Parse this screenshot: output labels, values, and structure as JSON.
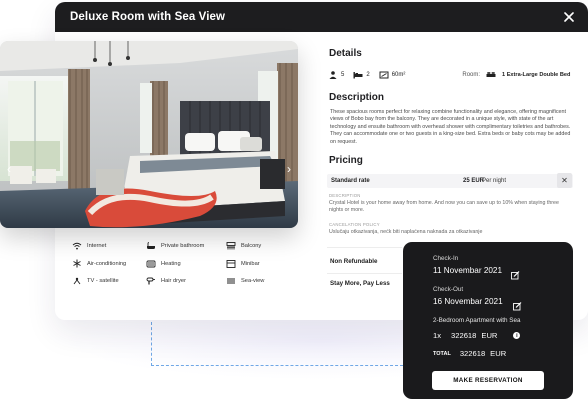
{
  "modal": {
    "title": "Deluxe Room with Sea View",
    "close_icon": "close-icon"
  },
  "details": {
    "heading": "Details",
    "persons": "5",
    "beds": "2",
    "area": "60m²",
    "room_label": "Room:",
    "bed_type": "1 Extra-Large Double Bed"
  },
  "description": {
    "heading": "Description",
    "text": "These spacious rooms perfect for relaxing combine functionality and elegance, offering magnificent views of Bobo bay from the balcony. They are decorated in a unique style, with state of the art technology and ensuite bathroom with overhead shower with complimentary toiletries and bathrobes. They can accommodate one or two guests in a king-size bed. Extra beds or baby cots may be added on request."
  },
  "pricing": {
    "heading": "Pricing",
    "rate_name": "Standard rate",
    "rate_price": "25 EUR",
    "rate_unit": "Per night",
    "desc_caption": "DESCRIPTION",
    "desc_text": "Crystal Hotel is your home away from home. And now you can save up to 10% when staying three nights or more.",
    "policy_caption": "CANCELATION POLICY",
    "policy_text": "Uslučaju otkazivanja, nećk biti naplaćena naknada za otkazivanje",
    "non_refundable": "Non Refundable",
    "stay_more": "Stay More, Pay Less"
  },
  "amenities": [
    {
      "label": "Internet",
      "icon": "wifi-icon"
    },
    {
      "label": "Private bathroom",
      "icon": "bathtub-icon"
    },
    {
      "label": "Balcony",
      "icon": "balcony-icon"
    },
    {
      "label": "Air-conditioning",
      "icon": "snowflake-icon"
    },
    {
      "label": "Heating",
      "icon": "heater-icon"
    },
    {
      "label": "Minibar",
      "icon": "minibar-icon"
    },
    {
      "label": "TV - satellite",
      "icon": "tv-icon"
    },
    {
      "label": "Hair dryer",
      "icon": "hair-dryer-icon"
    },
    {
      "label": "Sea-view",
      "icon": "waves-icon"
    }
  ],
  "gallery": {
    "prev_icon": "chevron-left-icon",
    "next_icon": "chevron-right-icon",
    "slides": 3
  },
  "booking": {
    "checkin_label": "Check-In",
    "checkin_date": "11 Novembar 2021",
    "checkout_label": "Check-Out",
    "checkout_date": "16 Novembar 2021",
    "room_name": "2-Bedroom Apartment with Sea",
    "qty": "1x",
    "price": "322618",
    "currency": "EUR",
    "total_label": "TOTAL",
    "total_price": "322618",
    "total_currency": "EUR",
    "reserve_button": "MAKE RESERVATION"
  }
}
